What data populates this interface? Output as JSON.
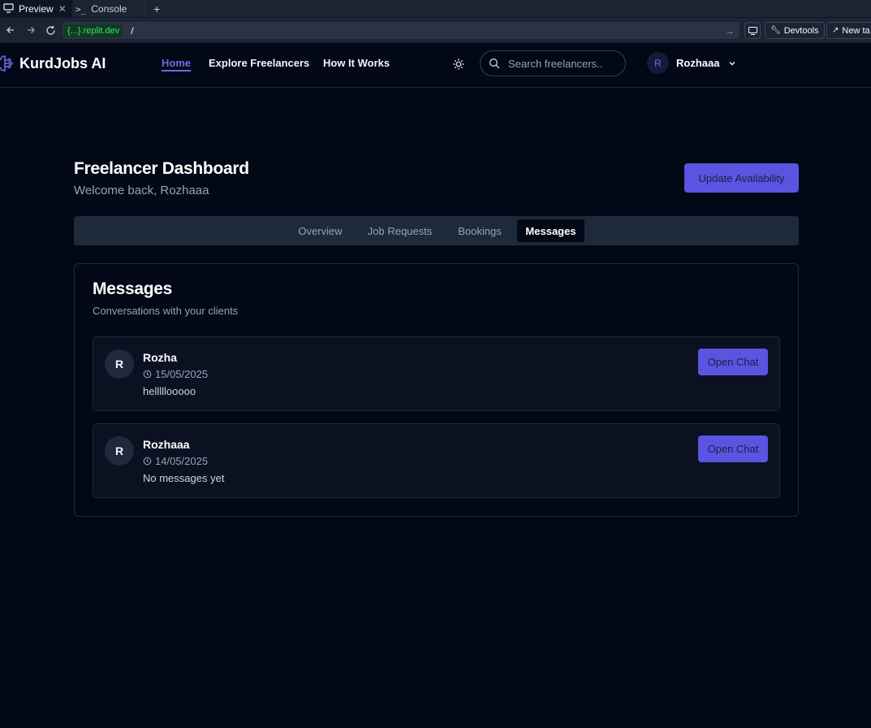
{
  "ide": {
    "tabs": [
      {
        "label": "Preview",
        "icon": "monitor-icon"
      },
      {
        "label": "Console",
        "icon": "terminal-icon"
      }
    ],
    "add_tab": "+",
    "url_domain": "{...}.replit.dev",
    "url_path": "/",
    "devtools_label": "Devtools",
    "new_tab_label": "New ta"
  },
  "header": {
    "brand": "KurdJobs AI",
    "nav": {
      "home": "Home",
      "explore": "Explore Freelancers",
      "how": "How It Works"
    },
    "search_placeholder": "Search freelancers..",
    "user": {
      "initial": "R",
      "name": "Rozhaaa"
    }
  },
  "dashboard": {
    "title": "Freelancer Dashboard",
    "subtitle": "Welcome back, Rozhaaa",
    "update_button": "Update Availability",
    "tabs": [
      "Overview",
      "Job Requests",
      "Bookings",
      "Messages"
    ],
    "active_tab": "Messages"
  },
  "messages": {
    "title": "Messages",
    "description": "Conversations with your clients",
    "open_chat_label": "Open Chat",
    "items": [
      {
        "initial": "R",
        "name": "Rozha",
        "date": "15/05/2025",
        "preview": "helllllooooo"
      },
      {
        "initial": "R",
        "name": "Rozhaaa",
        "date": "14/05/2025",
        "preview": "No messages yet"
      }
    ]
  },
  "colors": {
    "background": "#030816",
    "accent": "#5b54e0",
    "nav_active": "#6d6ae8",
    "surface": "#1e293b"
  }
}
